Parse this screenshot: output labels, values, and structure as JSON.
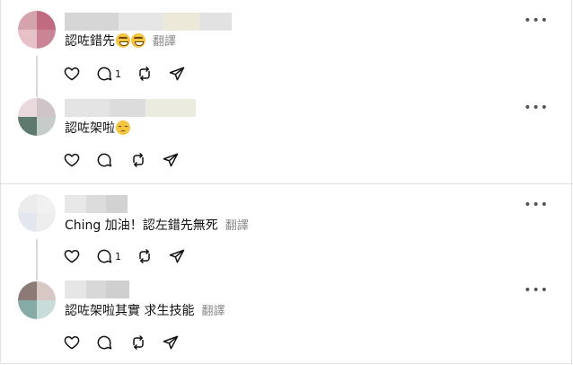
{
  "comments": [
    {
      "text": "認咗錯先",
      "emoji": [
        "grin",
        "grin"
      ],
      "translate": "翻譯",
      "reply_count": "1",
      "avatar_colors": [
        "#d4a3ad",
        "#c06b7f",
        "#e6c1c8",
        "#c98596"
      ]
    },
    {
      "text": "認咗架啦",
      "emoji": [
        "sad"
      ],
      "translate": "",
      "reply_count": "",
      "avatar_colors": [
        "#e9d9dc",
        "#cfc5c8",
        "#5e7a6e",
        "#c5ccc9"
      ]
    },
    {
      "text": "Ching 加油！認左錯先無死",
      "emoji": [],
      "translate": "翻譯",
      "reply_count": "1",
      "avatar_colors": [
        "#ececec",
        "#f1f1f1",
        "#e4e7ef",
        "#eeeeee"
      ]
    },
    {
      "text": "認咗架啦其實 求生技能",
      "emoji": [],
      "translate": "翻譯",
      "reply_count": "",
      "avatar_colors": [
        "#8c7a76",
        "#d7c7c5",
        "#86aaa6",
        "#c8dcda"
      ]
    }
  ],
  "icons": {
    "more": "more-horizontal-icon",
    "like": "heart-icon",
    "reply": "comment-bubble-icon",
    "repost": "repost-icon",
    "share": "send-icon"
  }
}
